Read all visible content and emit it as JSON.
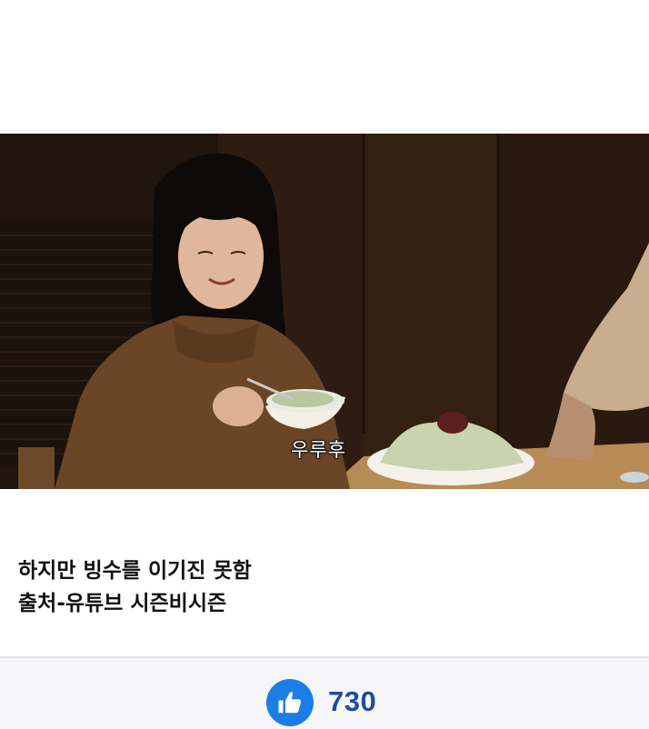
{
  "video": {
    "subtitle": "우루후"
  },
  "post": {
    "caption_line1": "하지만 빙수를 이기진 못함",
    "caption_line2": "출처-유튜브 시즌비시즌"
  },
  "reaction": {
    "icon": "thumbs-up-icon",
    "count": "730",
    "accent_color": "#1a7ee6",
    "count_color": "#1c4e9c"
  }
}
